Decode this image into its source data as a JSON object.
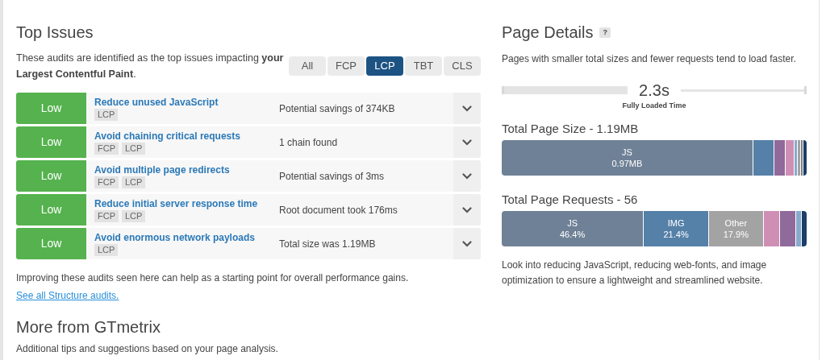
{
  "top_issues": {
    "title": "Top Issues",
    "intro": "These audits are identified as the top issues impacting **your Largest Contentful Paint**.",
    "tabs": [
      {
        "label": "All",
        "selected": false
      },
      {
        "label": "FCP",
        "selected": false
      },
      {
        "label": "LCP",
        "selected": true
      },
      {
        "label": "TBT",
        "selected": false
      },
      {
        "label": "CLS",
        "selected": false
      }
    ],
    "audits": [
      {
        "severity": "Low",
        "color": "#55b24e",
        "title": "Reduce unused JavaScript",
        "tags": [
          "LCP"
        ],
        "result": "Potential savings of 374KB"
      },
      {
        "severity": "Low",
        "color": "#55b24e",
        "title": "Avoid chaining critical requests",
        "tags": [
          "FCP",
          "LCP"
        ],
        "result": "1 chain found"
      },
      {
        "severity": "Low",
        "color": "#55b24e",
        "title": "Avoid multiple page redirects",
        "tags": [
          "FCP",
          "LCP"
        ],
        "result": "Potential savings of 3ms"
      },
      {
        "severity": "Low",
        "color": "#55b24e",
        "title": "Reduce initial server response time",
        "tags": [
          "FCP",
          "LCP"
        ],
        "result": "Root document took 176ms"
      },
      {
        "severity": "Low",
        "color": "#55b24e",
        "title": "Avoid enormous network payloads",
        "tags": [
          "LCP"
        ],
        "result": "Total size was 1.19MB"
      }
    ],
    "footer": "Improving these audits seen here can help as a starting point for overall performance gains.",
    "link": "See all Structure audits."
  },
  "more": {
    "title": "More from GTmetrix",
    "text": "Additional tips and suggestions based on your page analysis."
  },
  "page_details": {
    "title": "Page Details",
    "help": "?",
    "intro": "Pages with smaller total sizes and fewer requests tend to load faster.",
    "loaded_time": "2.3s",
    "loaded_label": "Fully Loaded Time",
    "size": {
      "title": "Total Page Size - 1.19MB",
      "segments": [
        {
          "label": "JS",
          "value": "0.97MB",
          "color": "#6f8196"
        },
        {
          "color": "#5580a8"
        },
        {
          "color": "#906a9a"
        },
        {
          "color": "#cf8fb5"
        },
        {
          "color": "#88aacd"
        },
        {
          "color": "#a3a3a3"
        },
        {
          "color": "#7f7f7f"
        },
        {
          "color": "#1d3e66"
        }
      ]
    },
    "requests": {
      "title": "Total Page Requests - 56",
      "segments": [
        {
          "label": "JS",
          "value": "46.4%",
          "color": "#6f8196"
        },
        {
          "label": "IMG",
          "value": "21.4%",
          "color": "#5580a8"
        },
        {
          "label": "Other",
          "value": "17.9%",
          "color": "#a3a3a3"
        },
        {
          "color": "#cf8fb5"
        },
        {
          "color": "#906a9a"
        },
        {
          "color": "#88aacd"
        },
        {
          "color": "#1d3e66"
        }
      ]
    },
    "advice": "Look into reducing JavaScript, reducing web-fonts, and image optimization to ensure a lightweight and streamlined website."
  }
}
